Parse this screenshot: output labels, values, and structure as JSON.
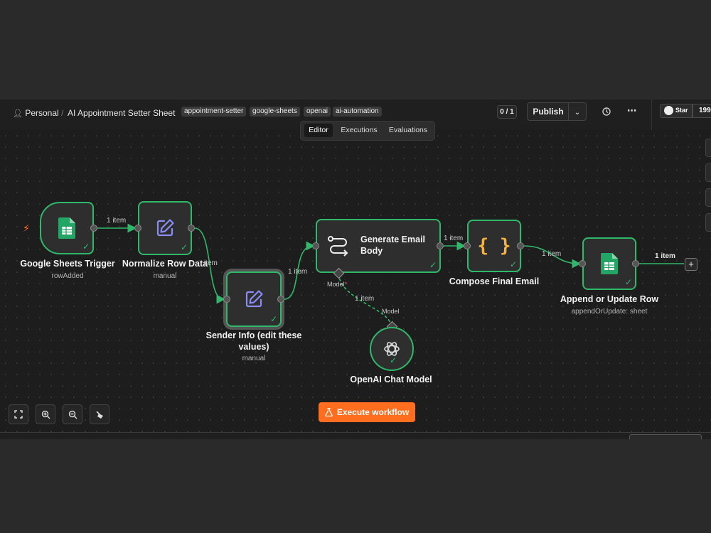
{
  "header": {
    "project": "Personal",
    "workflow_title": "AI Appointment Setter Sheet",
    "tags": [
      "appointment-setter",
      "google-sheets",
      "openai",
      "ai-automation"
    ],
    "counter": "0 / 1",
    "publish_label": "Publish",
    "github_label": "Star",
    "github_count": "199,"
  },
  "tabs": [
    {
      "label": "Editor",
      "active": true
    },
    {
      "label": "Executions",
      "active": false
    },
    {
      "label": "Evaluations",
      "active": false
    }
  ],
  "nodes": {
    "sheets_trigger": {
      "title": "Google Sheets Trigger",
      "subtitle": "rowAdded",
      "icon": "google-sheets-icon"
    },
    "normalize": {
      "title": "Normalize Row Data",
      "subtitle": "manual",
      "icon": "edit-icon"
    },
    "sender_info": {
      "title_line1": "Sender Info (edit these",
      "title_line2": "values)",
      "subtitle": "manual",
      "icon": "edit-icon"
    },
    "generate_email": {
      "title_line1": "Generate Email",
      "title_line2": "Body",
      "icon": "route-icon"
    },
    "compose_email": {
      "title": "Compose Final Email",
      "icon": "code-braces-icon"
    },
    "append_row": {
      "title": "Append or Update Row",
      "subtitle": "appendOrUpdate: sheet",
      "icon": "google-sheets-icon"
    },
    "openai_model": {
      "title": "OpenAI Chat Model",
      "icon": "openai-icon"
    }
  },
  "edges": {
    "e1": "1 item",
    "e2": "item",
    "e3": "1 item",
    "e4": "1 item",
    "e5": "1 item",
    "e6": "1 item",
    "e7": "1 item",
    "model_port_label": "Model",
    "model_required_mark": "*",
    "model_input_label": "Model"
  },
  "execute_label": "Execute workflow",
  "colors": {
    "success": "#2fb86a",
    "accent": "#ff6d1f",
    "canvas": "#1d1d1d"
  }
}
